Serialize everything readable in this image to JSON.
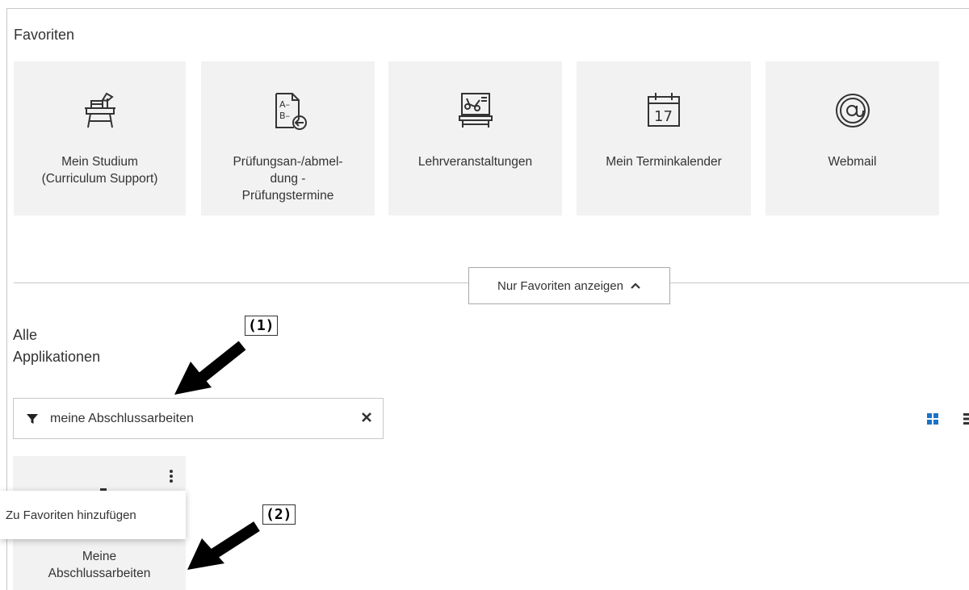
{
  "favorites": {
    "title": "Favoriten",
    "tiles": [
      {
        "label": "Mein Studium\n(Curriculum Support)",
        "icon": "desk-lamp-icon"
      },
      {
        "label": "Prüfungsan-/abmel-\ndung -\nPrüfungstermine",
        "icon": "exam-registration-icon"
      },
      {
        "label": "Lehrveranstaltungen",
        "icon": "lecture-board-icon"
      },
      {
        "label": "Mein Terminkalender",
        "icon": "calendar-icon",
        "icon_text": "17"
      },
      {
        "label": "Webmail",
        "icon": "at-sign-icon"
      }
    ]
  },
  "toggle_favorites": {
    "label": "Nur Favoriten anzeigen",
    "icon": "chevron-up-icon"
  },
  "all_apps": {
    "title_line1": "Alle",
    "title_line2": "Applikationen",
    "filter": {
      "icon": "filter-icon",
      "value": "meine Abschlussarbeiten",
      "clear_icon": "close-icon"
    },
    "view_toggles": [
      "grid-view-icon",
      "list-view-icon"
    ],
    "results": [
      {
        "label_line1": "Meine",
        "label_line2": "Abschlussarbeiten",
        "menu_icon": "more-vertical-icon"
      }
    ],
    "context_menu": {
      "item": "Zu Favoriten hinzufügen"
    }
  },
  "annotations": [
    {
      "label": "(1)"
    },
    {
      "label": "(2)"
    }
  ],
  "colors": {
    "accent": "#1a73c8",
    "tile_bg": "#f2f2f2",
    "border": "#c8c8c8"
  }
}
